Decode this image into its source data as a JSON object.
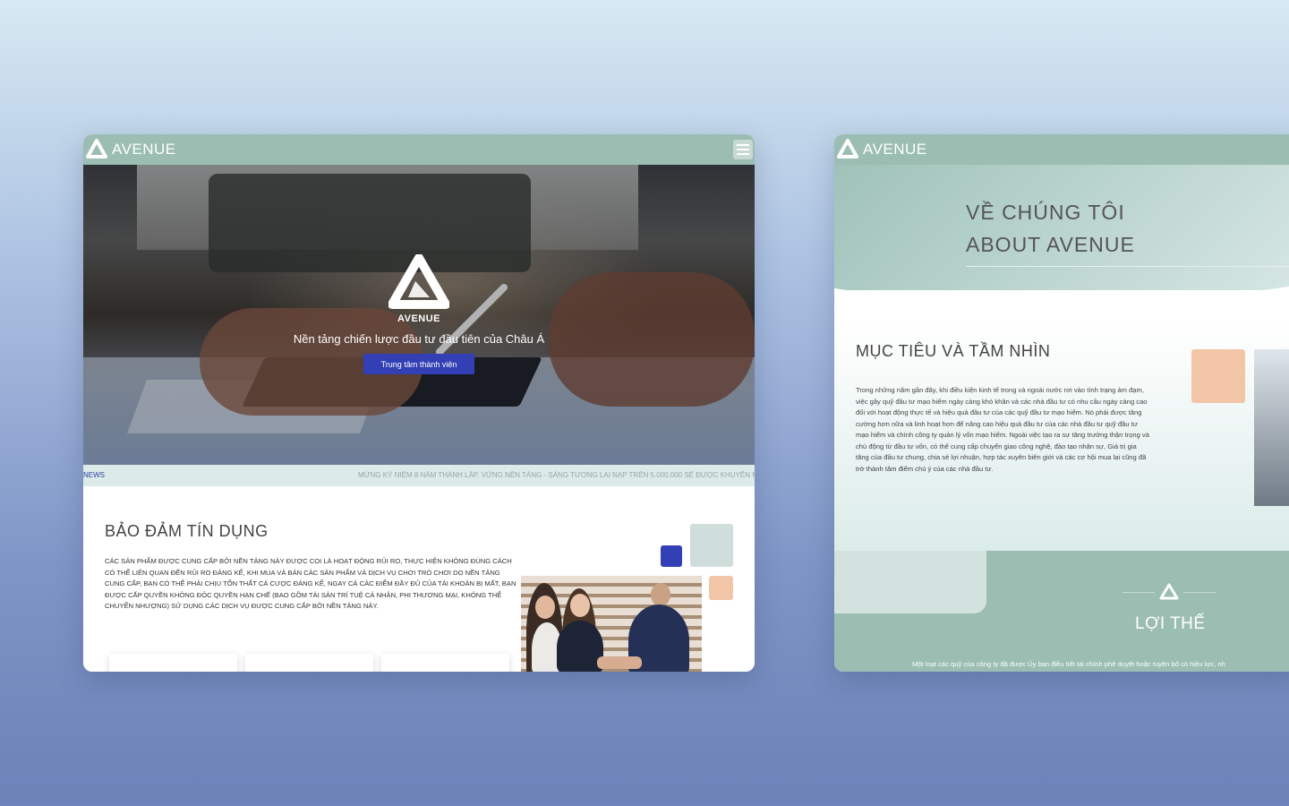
{
  "colors": {
    "header": "#9bbdb2",
    "accent_blue": "#3340b5",
    "accent_peach": "#f1c5a5",
    "mint": "#cfdedb"
  },
  "window1": {
    "brand": "AVENUE",
    "menu_icon": "hamburger-menu-icon",
    "hero": {
      "logo_text": "AVENUE",
      "tagline": "Nền tảng chiến lược đầu tư đầu tiên của Châu Á",
      "button": "Trung tâm thành viên"
    },
    "ticker": {
      "label": "NEWS",
      "text": "MỪNG KỶ NIỆM 8 NĂM THÀNH LẬP. VỮNG NỀN TẢNG - SÁNG TƯƠNG LAI NẠP TRÊN 5.000.000 SẼ ĐƯỢC KHUYẾN MÃI"
    },
    "credit": {
      "title": "BẢO ĐẢM TÍN DỤNG",
      "body": "Các sản phẩm được cung cấp bởi nền tảng này được coi là hoạt động rủi ro, thực hiện không đúng cách có thể liên quan đến rủi ro đáng kể, khi mua và bán các sản phẩm và dịch vụ chơi trò chơi do nền tảng cung cấp, bạn có thể phải chịu tổn thất cá cược đáng kể, ngay cả các điểm đầy đủ của tài khoản bị mất, bạn được cấp quyền không độc quyền hạn chế (bao gồm tài sản trí tuệ cá nhân, phi thương mại, không thể chuyển nhượng) sử dụng các dịch vụ được cung cấp bởi nền tảng này."
    }
  },
  "window2": {
    "brand": "AVENUE",
    "about": {
      "line1": "VỀ CHÚNG TÔI",
      "line2": "ABOUT AVENUE"
    },
    "mission": {
      "title": "MỤC TIÊU VÀ TẦM NHÌN",
      "body": "Trong những năm gần đây, khi điều kiện kinh tế trong và ngoài nước rơi vào tình trạng ảm đạm, việc gây quỹ đầu tư mạo hiểm ngày càng khó khăn và các nhà đầu tư có nhu cầu ngày càng cao đối với hoạt động thực tế và hiệu quả đầu tư của các quỹ đầu tư mạo hiểm. Nó phải được tăng cường hơn nữa và linh hoạt hơn để nâng cao hiệu quả đầu tư của các nhà đầu tư quỹ đầu tư mạo hiểm và chính công ty quản lý vốn mạo hiểm. Ngoài việc tạo ra sự tăng trưởng thận trọng và chủ động từ đầu tư vốn, có thể cung cấp chuyển giao công nghệ, đào tạo nhân sự, Giá trị gia tăng của đầu tư chung, chia sẻ lợi nhuận, hợp tác xuyên biên giới và các cơ hội mua lại cũng đã trở thành tâm điểm chú ý của các nhà đầu tư."
    },
    "advantage": {
      "title": "LỢI THẾ",
      "body": "Một loạt các quỹ của công ty đã được Ủy ban điều tiết tài chính phê duyệt hoặc tuyên bố có hiệu lực, nh"
    }
  }
}
